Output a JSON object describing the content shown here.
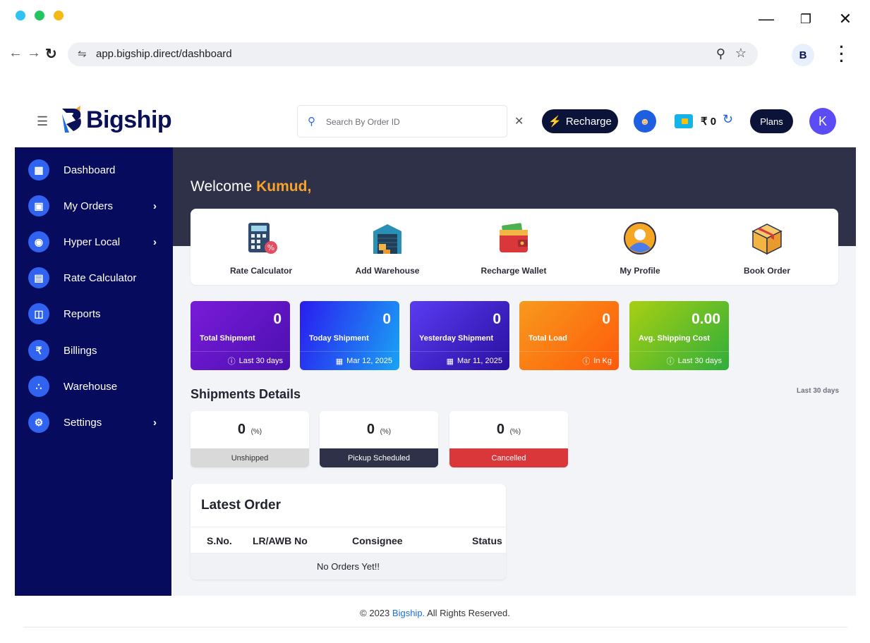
{
  "browser": {
    "url": "app.bigship.direct/dashboard",
    "traffic_colors": [
      "#2ec4f1",
      "#22c55e",
      "#f5b914"
    ]
  },
  "header": {
    "brand": "Bigship",
    "search_placeholder": "Search By Order ID",
    "recharge_label": "Recharge",
    "balance": "₹ 0",
    "plans_label": "Plans",
    "avatar_initial": "K"
  },
  "sidebar": {
    "items": [
      {
        "label": "Dashboard",
        "icon": "grid-icon",
        "chevron": false
      },
      {
        "label": "My Orders",
        "icon": "orders-icon",
        "chevron": true
      },
      {
        "label": "Hyper Local",
        "icon": "location-icon",
        "chevron": true
      },
      {
        "label": "Rate Calculator",
        "icon": "calculator-icon",
        "chevron": false
      },
      {
        "label": "Reports",
        "icon": "reports-icon",
        "chevron": false
      },
      {
        "label": "Billings",
        "icon": "rupee-icon",
        "chevron": false
      },
      {
        "label": "Warehouse",
        "icon": "network-icon",
        "chevron": false
      },
      {
        "label": "Settings",
        "icon": "gear-icon",
        "chevron": true
      }
    ]
  },
  "welcome": {
    "prefix": "Welcome",
    "name": "Kumud,"
  },
  "quick_actions": [
    {
      "label": "Rate Calculator",
      "icon": "calculator-icon"
    },
    {
      "label": "Add Warehouse",
      "icon": "warehouse-icon"
    },
    {
      "label": "Recharge Wallet",
      "icon": "wallet-icon"
    },
    {
      "label": "My Profile",
      "icon": "profile-icon"
    },
    {
      "label": "Book Order",
      "icon": "box-icon"
    }
  ],
  "stats": [
    {
      "value": "0",
      "title": "Total Shipment",
      "foot": "Last 30 days",
      "foot_icon": "info-icon",
      "gradient": [
        "#7a1bd9",
        "#4a10b0"
      ]
    },
    {
      "value": "0",
      "title": "Today Shipment",
      "foot": "Mar 12, 2025",
      "foot_icon": "calendar-icon",
      "gradient": [
        "#2a1cf0",
        "#1aa3f4"
      ]
    },
    {
      "value": "0",
      "title": "Yesterday Shipment",
      "foot": "Mar 11, 2025",
      "foot_icon": "calendar-icon",
      "gradient": [
        "#5a3cf2",
        "#2a0fa0"
      ]
    },
    {
      "value": "0",
      "title": "Total Load",
      "foot": "In Kg",
      "foot_icon": "info-icon",
      "gradient": [
        "#f79a1d",
        "#ff5a0a"
      ]
    },
    {
      "value": "0.00",
      "title": "Avg. Shipping Cost",
      "foot": "Last 30 days",
      "foot_icon": "info-icon",
      "gradient": [
        "#a8cf12",
        "#2fae3a"
      ]
    }
  ],
  "shipments": {
    "title": "Shipments Details",
    "period": "Last 30 days",
    "cards": [
      {
        "value": "0",
        "unit": "(%)",
        "label": "Unshipped",
        "foot_bg": "#d9d9d9",
        "foot_color": "#333333"
      },
      {
        "value": "0",
        "unit": "(%)",
        "label": "Pickup Scheduled",
        "foot_bg": "#2f3148",
        "foot_color": "#ffffff"
      },
      {
        "value": "0",
        "unit": "(%)",
        "label": "Cancelled",
        "foot_bg": "#d9373a",
        "foot_color": "#ffffff"
      }
    ]
  },
  "latest_order": {
    "title": "Latest Order",
    "columns": [
      "S.No.",
      "LR/AWB No",
      "Consignee",
      "Status"
    ],
    "empty": "No Orders Yet!!"
  },
  "footer": {
    "prefix": "© 2023",
    "brand": "Bigship.",
    "suffix": "All Rights Reserved."
  }
}
